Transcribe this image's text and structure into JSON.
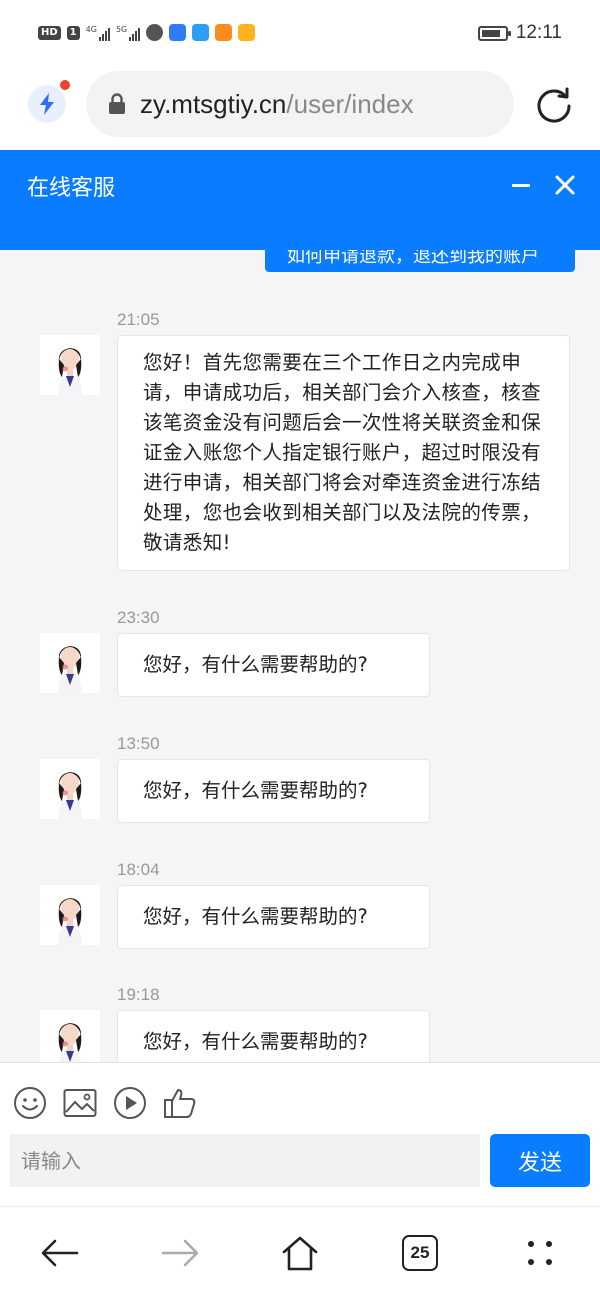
{
  "status_bar": {
    "time": "12:11",
    "hd_label": "HD",
    "sim_label": "1",
    "net1_label": "4G",
    "net2_label": "5G",
    "icons": [
      "hd-icon",
      "signal-4g-icon",
      "signal-5g-icon",
      "app-icon-1",
      "app-icon-2",
      "app-icon-3",
      "app-icon-4",
      "app-icon-5",
      "battery-icon"
    ],
    "app_colors": [
      "#555555",
      "#2f7cf6",
      "#2f9cf6",
      "#ff8a1e",
      "#ffb21e"
    ]
  },
  "browser": {
    "url_host": "zy.mtsgtiy.cn",
    "url_path": "/user/index",
    "icons": [
      "bolt-icon",
      "lock-icon",
      "reload-icon"
    ]
  },
  "header": {
    "title": "在线客服",
    "color": "#0a7cff"
  },
  "chat": {
    "partial_user_message": "如何申请退款，退还到我的账户",
    "messages": [
      {
        "time": "21:05",
        "text": "您好！首先您需要在三个工作日之内完成申请，申请成功后，相关部门会介入核查，核查该笔资金没有问题后会一次性将关联资金和保证金入账您个人指定银行账户，超过时限没有进行申请，相关部门将会对牵连资金进行冻结处理，您也会收到相关部门以及法院的传票，敬请悉知!"
      },
      {
        "time": "23:30",
        "text": "您好，有什么需要帮助的?"
      },
      {
        "time": "13:50",
        "text": "您好，有什么需要帮助的?"
      },
      {
        "time": "18:04",
        "text": "您好，有什么需要帮助的?"
      },
      {
        "time": "19:18",
        "text": "您好，有什么需要帮助的?"
      }
    ]
  },
  "composer": {
    "placeholder": "请输入",
    "value": "",
    "send_label": "发送",
    "tools": [
      "emoji-icon",
      "image-icon",
      "video-icon",
      "thumbs-up-icon"
    ]
  },
  "bottom_nav": {
    "tabs_count": "25",
    "icons": [
      "back-icon",
      "forward-icon",
      "home-icon",
      "tabs-icon",
      "menu-icon"
    ]
  }
}
